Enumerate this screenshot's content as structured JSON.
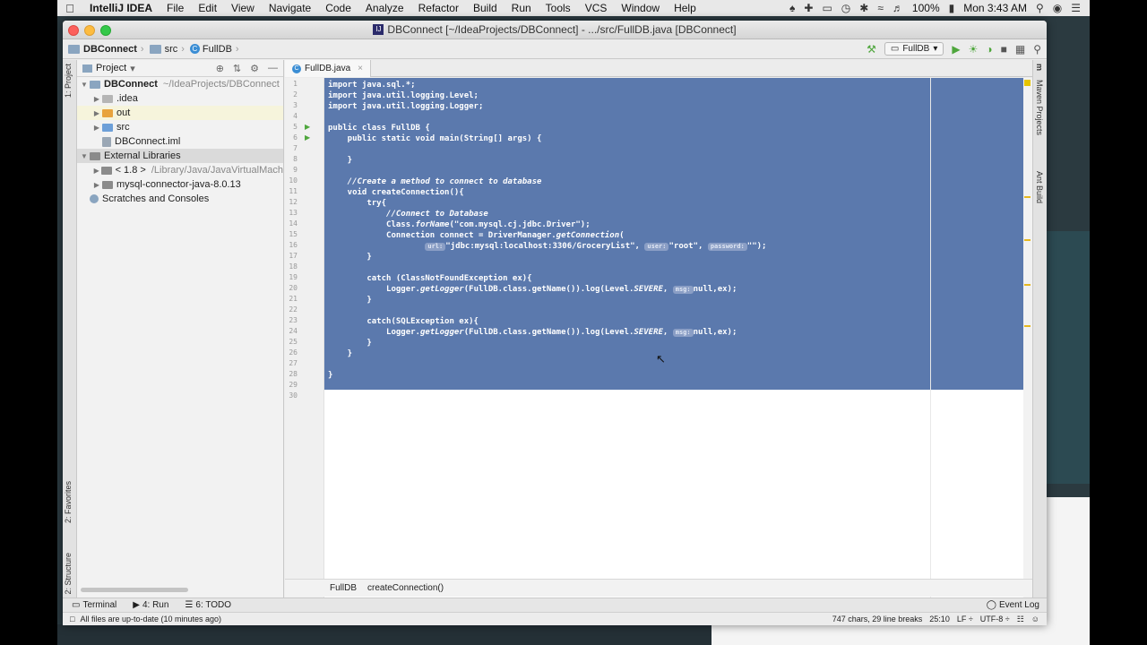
{
  "menubar": {
    "app_name": "IntelliJ IDEA",
    "items": [
      "File",
      "Edit",
      "View",
      "Navigate",
      "Code",
      "Analyze",
      "Refactor",
      "Build",
      "Run",
      "Tools",
      "VCS",
      "Window",
      "Help"
    ],
    "battery": "100%",
    "clock": "Mon 3:43 AM"
  },
  "window": {
    "title": "DBConnect [~/IdeaProjects/DBConnect] - .../src/FullDB.java [DBConnect]"
  },
  "navbar": {
    "crumbs": [
      "DBConnect",
      "src",
      "FullDB"
    ],
    "run_config": "FullDB"
  },
  "left_strip": {
    "project_tab": "1: Project",
    "favorites_tab": "2: Favorites",
    "structure_tab": "2: Structure"
  },
  "project_panel": {
    "header": "Project",
    "tree": [
      {
        "label": "DBConnect",
        "dim": "~/IdeaProjects/DBConnect"
      },
      {
        "label": ".idea"
      },
      {
        "label": "out"
      },
      {
        "label": "src"
      },
      {
        "label": "DBConnect.iml"
      },
      {
        "label": "External Libraries"
      },
      {
        "label": "< 1.8 >",
        "dim": "/Library/Java/JavaVirtualMach"
      },
      {
        "label": "mysql-connector-java-8.0.13"
      },
      {
        "label": "Scratches and Consoles"
      }
    ]
  },
  "editor": {
    "tab_label": "FullDB.java",
    "line_numbers": [
      "1",
      "2",
      "3",
      "4",
      "5",
      "6",
      "7",
      "8",
      "9",
      "10",
      "11",
      "12",
      "13",
      "14",
      "15",
      "16",
      "17",
      "18",
      "19",
      "20",
      "21",
      "22",
      "23",
      "24",
      "25",
      "26",
      "27",
      "28",
      "29",
      "30"
    ],
    "hints": {
      "url": "url:",
      "user": "user:",
      "password": "password:",
      "msg": "msg:"
    },
    "code": {
      "l1": "import java.sql.*;",
      "l2": "import java.util.logging.Level;",
      "l3": "import java.util.logging.Logger;",
      "l5": "public class FullDB {",
      "l6": "    public static void main(String[] args) {",
      "l8": "    }",
      "l10": "    //Create a method to connect to database",
      "l11": "    void createConnection(){",
      "l12": "        try{",
      "l13": "            //Connect to Database",
      "l14a": "            Class.",
      "l14b": "forName",
      "l14c": "(\"com.mysql.cj.jdbc.Driver\");",
      "l15a": "            Connection connect = DriverManager.",
      "l15b": "getConnection",
      "l15c": "(",
      "l16a": "                    ",
      "l16b": "\"jdbc:mysql:localhost:3306/GroceryList\", ",
      "l16c": "\"root\", ",
      "l16d": "\"\");",
      "l17": "        }",
      "l19": "        catch (ClassNotFoundException ex){",
      "l20a": "            Logger.",
      "l20b": "getLogger",
      "l20c": "(FullDB.class.getName()).log(Level.",
      "l20d": "SEVERE",
      "l20e": ", ",
      "l20f": "null,ex);",
      "l21": "        }",
      "l23": "        catch(SQLException ex){",
      "l24a": "            Logger.",
      "l24b": "getLogger",
      "l24c": "(FullDB.class.getName()).log(Level.",
      "l24d": "SEVERE",
      "l24e": ", ",
      "l24f": "null,ex);",
      "l25": "        }",
      "l26": "    }",
      "l28": "}"
    },
    "breadcrumbs": [
      "FullDB",
      "createConnection()"
    ]
  },
  "right_strip": {
    "maven_tab": "Maven Projects",
    "ant_tab": "Ant Build"
  },
  "tool_bar": {
    "terminal": "Terminal",
    "run": "4: Run",
    "todo": "6: TODO",
    "event_log": "Event Log"
  },
  "status_bar": {
    "message": "All files are up-to-date (10 minutes ago)",
    "chars": "747 chars, 29 line breaks",
    "position": "25:10",
    "line_sep": "LF ÷",
    "encoding": "UTF-8 ÷"
  },
  "colors": {
    "selection": "#5b79ad",
    "menubar_bg": "#e8e8e8",
    "run_green": "#4ea63c",
    "warning_stripe": "#e6b821"
  }
}
